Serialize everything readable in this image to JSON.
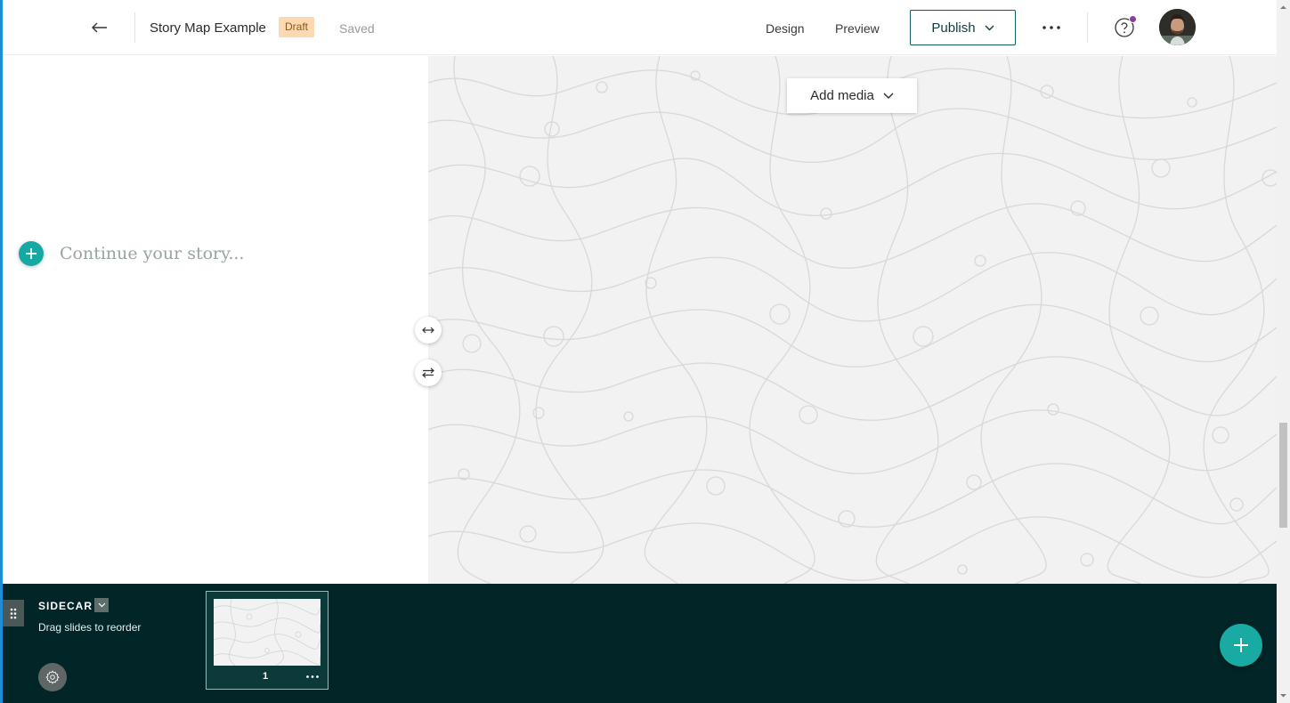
{
  "header": {
    "story_title": "Story Map Example",
    "status_badge": "Draft",
    "save_status": "Saved",
    "nav": {
      "design": "Design",
      "preview": "Preview"
    },
    "publish_label": "Publish"
  },
  "narrative": {
    "placeholder": "Continue your story..."
  },
  "media": {
    "add_media_label": "Add media"
  },
  "sidecar": {
    "title": "SIDECAR",
    "hint": "Drag slides to reorder",
    "slides": [
      {
        "number": "1"
      }
    ]
  },
  "colors": {
    "accent_teal": "#16a8a3",
    "bottom_bar": "#022627",
    "draft_badge_bg": "#fcd9b1",
    "notification_dot": "#8e3d9c",
    "left_accent": "#1e8fd6"
  },
  "icons": {
    "back": "arrow-left-icon",
    "publish_caret": "chevron-down-icon",
    "more": "ellipsis-icon",
    "help": "question-circle-icon",
    "add_block": "plus-icon",
    "resize": "horizontal-resize-icon",
    "swap": "swap-panels-icon",
    "settings": "gear-icon",
    "add_slide": "plus-icon"
  }
}
